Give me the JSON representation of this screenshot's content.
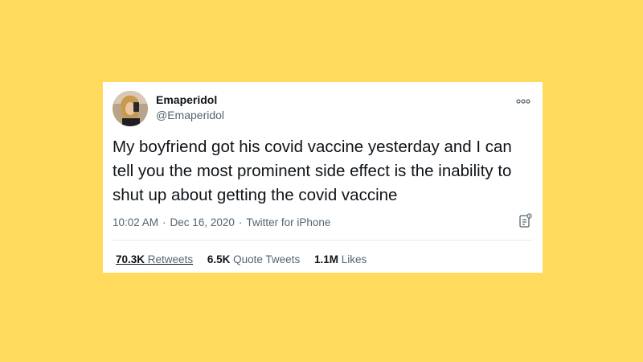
{
  "tweet": {
    "author": {
      "name": "Emaperidol",
      "handle": "@Emaperidol"
    },
    "text": "My boyfriend got his covid vaccine yesterday and I can tell you the most prominent side effect is the inability to shut up about getting the covid vaccine",
    "time": "10:02 AM",
    "separator": "·",
    "date": "Dec 16, 2020",
    "source": "Twitter for iPhone",
    "stats": {
      "retweets_count": "70.3K",
      "retweets_label": "Retweets",
      "quote_count": "6.5K",
      "quote_label": "Quote Tweets",
      "likes_count": "1.1M",
      "likes_label": "Likes"
    }
  },
  "icons": {
    "more": "more-options-icon",
    "analytics": "analytics-icon",
    "avatar": "avatar"
  },
  "colors": {
    "background": "#FFDA5C",
    "card": "#FFFFFF",
    "primary_text": "#0f1419",
    "secondary_text": "#536471",
    "divider": "#e7e9ea"
  }
}
